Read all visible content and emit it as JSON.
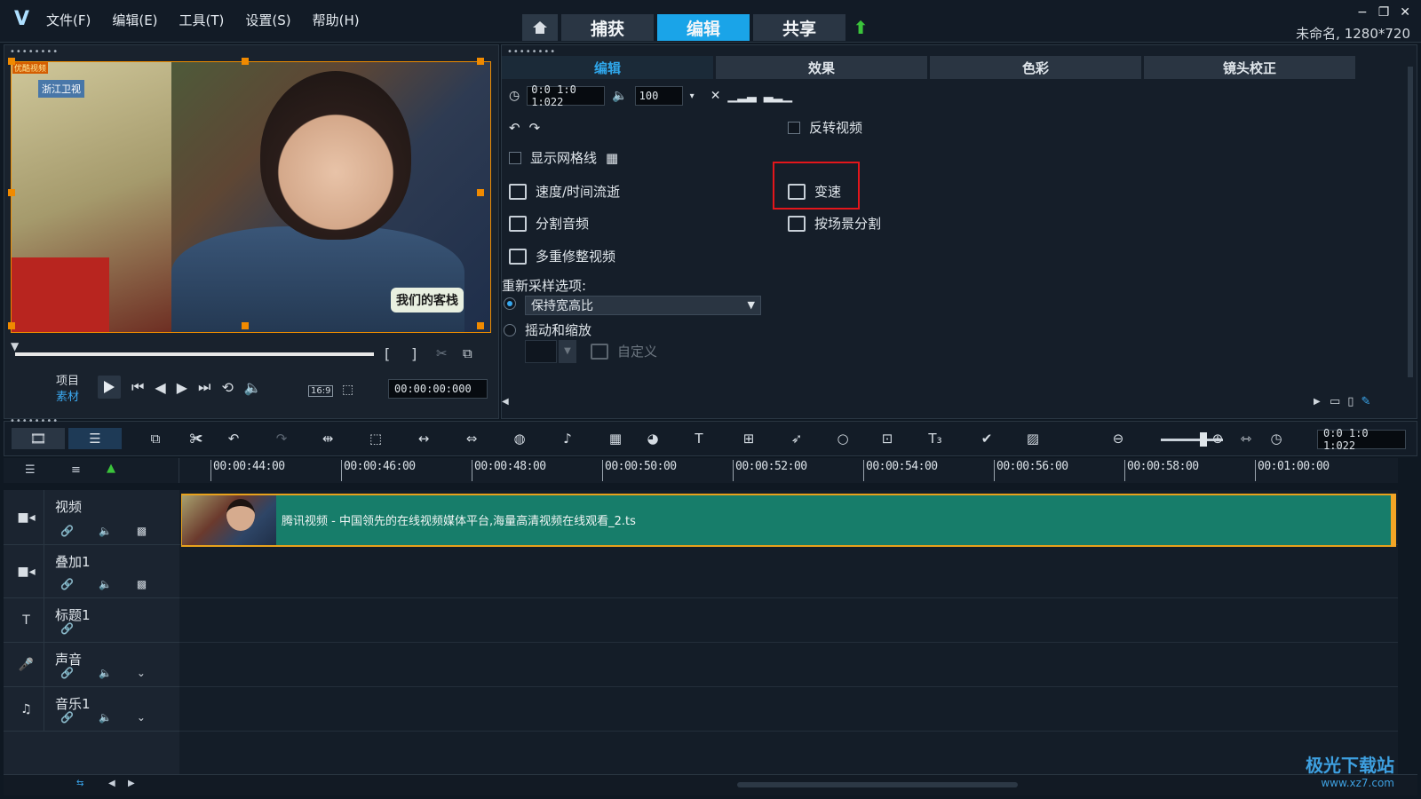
{
  "app": {
    "menu": [
      "文件(F)",
      "编辑(E)",
      "工具(T)",
      "设置(S)",
      "帮助(H)"
    ],
    "mode_tabs": [
      "捕获",
      "编辑",
      "共享"
    ],
    "active_mode": "编辑",
    "window_controls": [
      "−",
      "❐",
      "✕"
    ],
    "project_info": "未命名, 1280*720"
  },
  "preview": {
    "logo_text": "浙江卫视",
    "tag_text": "优酷视频",
    "watermark_text": "我们的客栈",
    "project_label": "项目",
    "clip_label": "素材",
    "aspect": "16:9",
    "timecode": "00:00:00:000",
    "bracket_in": "[",
    "bracket_out": "]"
  },
  "options": {
    "tabs": [
      "编辑",
      "效果",
      "色彩",
      "镜头校正"
    ],
    "active_tab": "编辑",
    "duration": "0:0 1:0 1:022",
    "volume": "100",
    "reverse_video": "反转视频",
    "show_grid": "显示网格线",
    "speed_time_lapse": "速度/时间流逝",
    "variable_speed": "变速",
    "split_audio": "分割音频",
    "split_by_scene": "按场景分割",
    "multi_trim": "多重修整视频",
    "resample_label": "重新采样选项:",
    "keep_aspect": "保持宽高比",
    "pan_zoom": "摇动和缩放",
    "custom": "自定义"
  },
  "timeline": {
    "timecode": "0:0 1:0 1:022",
    "ruler_ticks": [
      "00:00:44:00",
      "00:00:46:00",
      "00:00:48:00",
      "00:00:50:00",
      "00:00:52:00",
      "00:00:54:00",
      "00:00:56:00",
      "00:00:58:00",
      "00:01:00:00"
    ],
    "tracks": [
      {
        "name": "视频",
        "icon": "video-camera-icon"
      },
      {
        "name": "叠加1",
        "icon": "overlay-camera-icon"
      },
      {
        "name": "标题1",
        "icon": "title-icon"
      },
      {
        "name": "声音",
        "icon": "voice-icon"
      },
      {
        "name": "音乐1",
        "icon": "music-icon"
      }
    ],
    "clip_name": "腾讯视频 - 中国领先的在线视频媒体平台,海量高清视频在线观看_2.ts"
  },
  "watermark": {
    "title": "极光下载站",
    "url": "www.xz7.com"
  }
}
